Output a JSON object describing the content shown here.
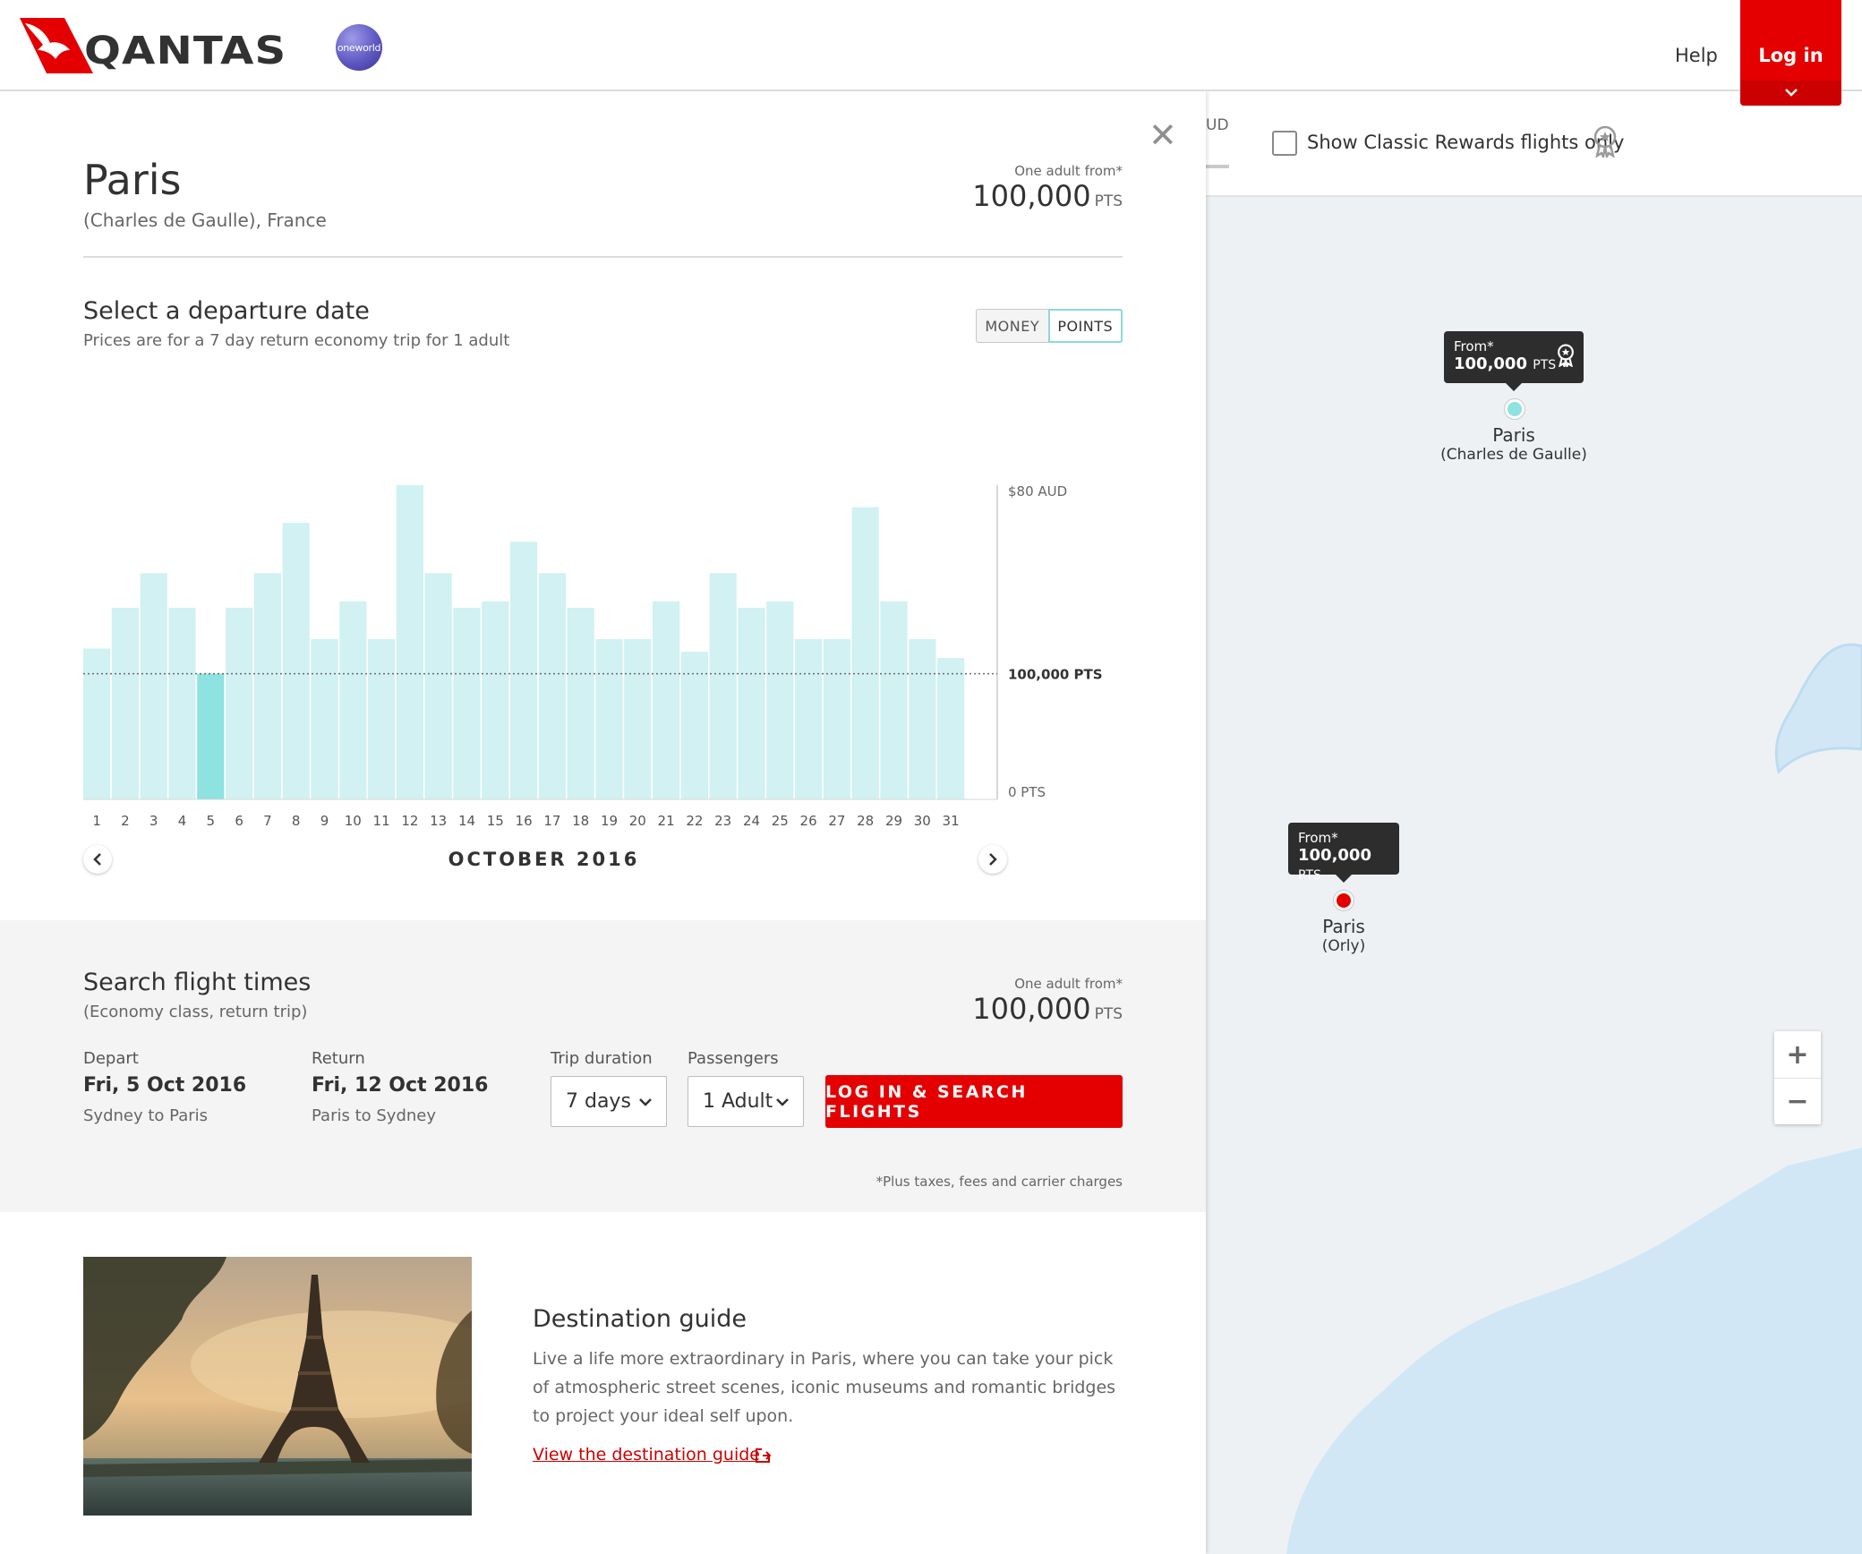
{
  "header": {
    "brand": "QANTAS",
    "alliance": "oneworld",
    "help_label": "Help",
    "login_label": "Log in",
    "colors": {
      "brand_red": "#e40000",
      "accent_teal": "#8ee2e0"
    }
  },
  "map": {
    "currency_fragment": "UD",
    "classic_rewards_label": "Show Classic Rewards flights only",
    "classic_rewards_checked": false,
    "classic_icon": "award-ribbon-icon",
    "pins": [
      {
        "from_label": "From*",
        "points_value": "100,000",
        "points_unit": "PTS",
        "city": "Paris",
        "airport": "(Charles de Gaulle)",
        "status": "selected",
        "color": "#8ee2e0",
        "has_award_icon": true
      },
      {
        "from_label": "From*",
        "points_value": "100,000",
        "points_unit": "PTS",
        "city": "Paris",
        "airport": "(Orly)",
        "status": "default",
        "color": "#e40000",
        "has_award_icon": false
      }
    ],
    "zoom_in_label": "+",
    "zoom_out_label": "−"
  },
  "panel": {
    "close_icon": "close-icon",
    "destination": {
      "title": "Paris",
      "subtitle": "(Charles de Gaulle), France"
    },
    "top_price": {
      "from_label": "One adult from*",
      "value": "100,000",
      "unit": "PTS"
    },
    "select_date": {
      "title": "Select a departure date",
      "subtitle": "Prices are for a 7 day return economy trip for 1 adult",
      "toggle": {
        "money_label": "MONEY",
        "points_label": "POINTS",
        "active": "points"
      },
      "month_label": "OCTOBER 2016",
      "prev_icon": "chevron-left-icon",
      "next_icon": "chevron-right-icon"
    },
    "search": {
      "title": "Search flight times",
      "subtitle": "(Economy class, return trip)",
      "price": {
        "from_label": "One adult from*",
        "value": "100,000",
        "unit": "PTS"
      },
      "depart": {
        "label": "Depart",
        "date": "Fri, 5 Oct 2016",
        "route": "Sydney to Paris"
      },
      "return": {
        "label": "Return",
        "date": "Fri, 12 Oct 2016",
        "route": "Paris to Sydney"
      },
      "trip_duration": {
        "label": "Trip duration",
        "value": "7 days"
      },
      "passengers": {
        "label": "Passengers",
        "value": "1 Adult"
      },
      "cta_label": "LOG IN & SEARCH FLIGHTS",
      "fine_print": "*Plus taxes, fees and carrier charges"
    },
    "guide": {
      "title": "Destination guide",
      "text": "Live a life more extraordinary in Paris, where you can take your pick of atmospheric street scenes, iconic museums and romantic bridges to project your ideal self upon.",
      "link_label": "View the destination guide",
      "link_icon": "external-link-icon",
      "image": "eiffel-tower-photo"
    }
  },
  "chart_data": {
    "type": "bar",
    "categories": [
      "1",
      "2",
      "3",
      "4",
      "5",
      "6",
      "7",
      "8",
      "9",
      "10",
      "11",
      "12",
      "13",
      "14",
      "15",
      "16",
      "17",
      "18",
      "19",
      "20",
      "21",
      "22",
      "23",
      "24",
      "25",
      "26",
      "27",
      "28",
      "29",
      "30",
      "31"
    ],
    "values": [
      48,
      61,
      72,
      61,
      40,
      61,
      72,
      88,
      51,
      63,
      51,
      100,
      72,
      61,
      63,
      82,
      72,
      61,
      51,
      51,
      63,
      47,
      72,
      61,
      63,
      51,
      51,
      93,
      63,
      51,
      45
    ],
    "selected_index": 4,
    "reference_line": {
      "value": 40,
      "label": "100,000 PTS"
    },
    "y_labels": {
      "top": "$80 AUD",
      "bottom": "0 PTS"
    },
    "ylim": [
      0,
      100
    ],
    "bar_color": "#d1f1f2",
    "selected_color": "#8ee2e0",
    "grid": false
  }
}
